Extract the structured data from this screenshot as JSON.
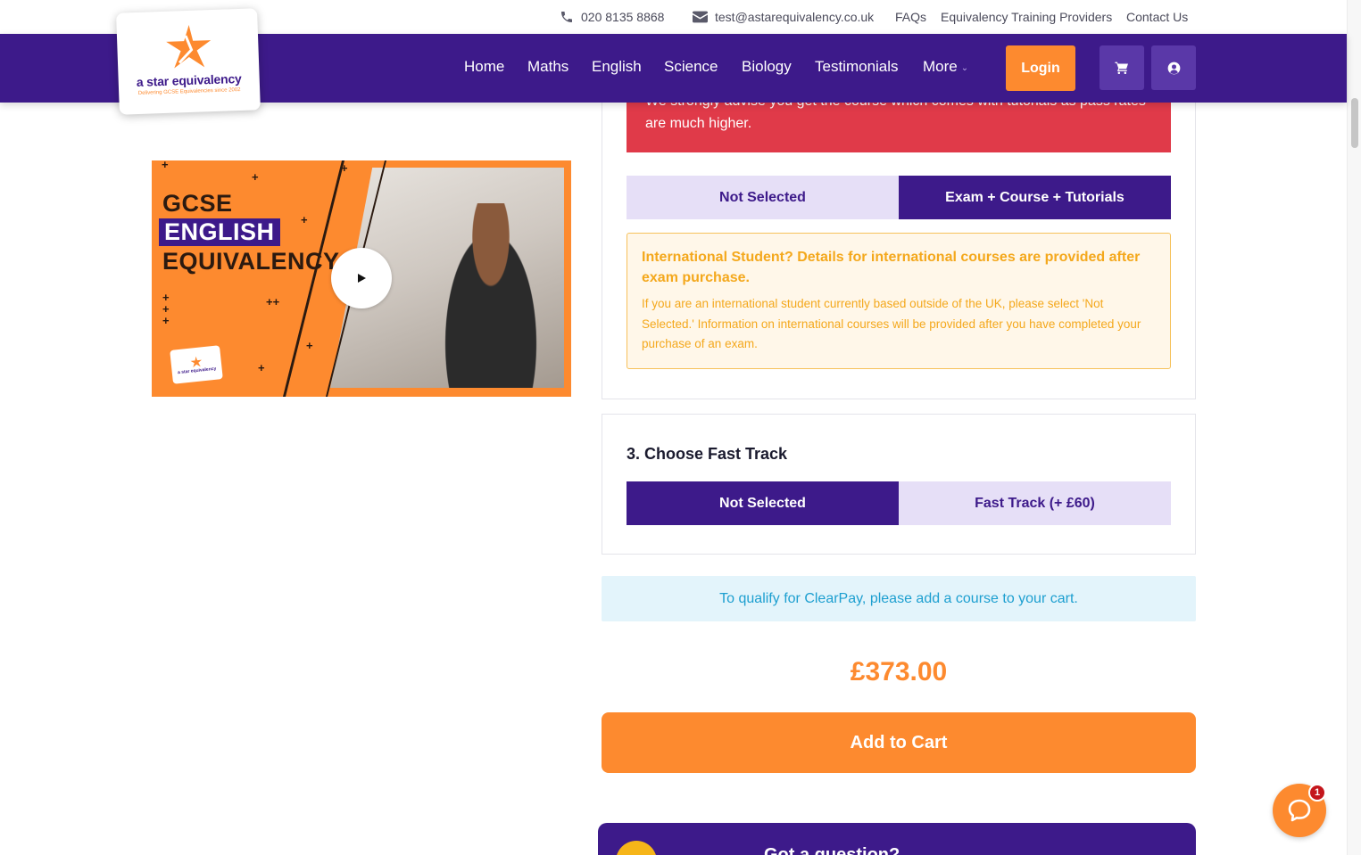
{
  "topbar": {
    "phone": "020 8135 8868",
    "email": "test@astarequivalency.co.uk",
    "links": [
      "FAQs",
      "Equivalency Training Providers",
      "Contact Us"
    ]
  },
  "logo": {
    "name": "a star equivalency",
    "tagline": "Delivering GCSE Equivalencies since 2002"
  },
  "nav": {
    "items": [
      "Home",
      "Maths",
      "English",
      "Science",
      "Biology",
      "Testimonials",
      "More"
    ],
    "login_label": "Login",
    "icons": [
      "cart-icon",
      "user-icon"
    ]
  },
  "video": {
    "title_line1": "GCSE",
    "title_line2": "ENGLISH",
    "title_line3": "EQUIVALENCY",
    "mini_logo": "a star equivalency"
  },
  "tutorial_section": {
    "warning": "We strongly advise you get the course which comes with tutorials as pass rates are much higher.",
    "options": [
      "Not Selected",
      "Exam + Course + Tutorials"
    ],
    "selected_index": 1,
    "international": {
      "heading": "International Student? Details for international courses are provided after exam purchase.",
      "body": "If you are an international student currently based outside of the UK, please select 'Not Selected.' Information on international courses will be provided after you have completed your purchase of an exam."
    }
  },
  "fast_track": {
    "title": "3. Choose Fast Track",
    "options": [
      "Not Selected",
      "Fast Track (+ £60)"
    ],
    "selected_index": 0
  },
  "clearpay_notice": "To qualify for ClearPay, please add a course to your cart.",
  "price": "£373.00",
  "add_to_cart_label": "Add to Cart",
  "question_banner": "Got a question?",
  "chat": {
    "badge_count": "1"
  },
  "colors": {
    "brand_purple": "#3d1a8a",
    "brand_orange": "#fd8a2f",
    "alert_red": "#e03a49",
    "info_blue": "#1d9fd0"
  }
}
